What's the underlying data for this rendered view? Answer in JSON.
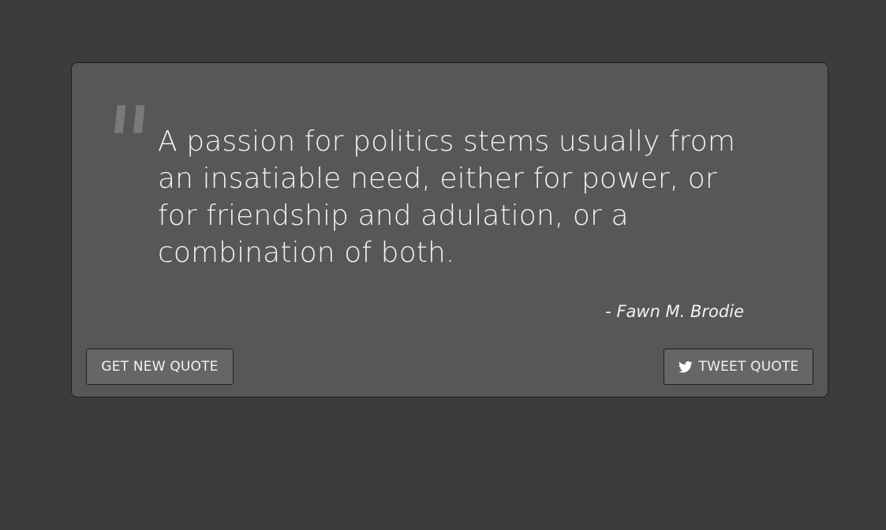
{
  "quote": {
    "mark": "\"",
    "text": "A passion for politics stems usually from an insatiable need, either for power, or for friendship and adulation, or a combination of both.",
    "author": "- Fawn M. Brodie"
  },
  "buttons": {
    "new_quote_label": "GET NEW QUOTE",
    "tweet_label": "TWEET QUOTE"
  },
  "icons": {
    "tweet": "twitter-icon",
    "quote": "quote-icon"
  },
  "colors": {
    "background": "#3c3c3c",
    "card": "#575757",
    "button": "#666666",
    "text": "#f2f2f2",
    "quote_mark": "#7a7a7a"
  }
}
